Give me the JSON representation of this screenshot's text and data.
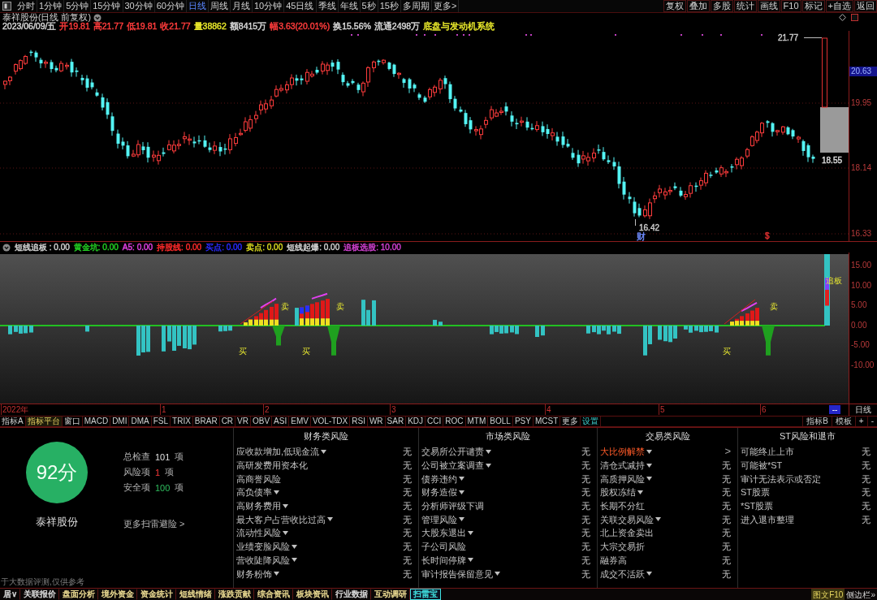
{
  "toolbar": {
    "periods": [
      {
        "label": "分时",
        "selected": false
      },
      {
        "label": "1分钟",
        "selected": false
      },
      {
        "label": "5分钟",
        "selected": false
      },
      {
        "label": "15分钟",
        "selected": false
      },
      {
        "label": "30分钟",
        "selected": false
      },
      {
        "label": "60分钟",
        "selected": false
      },
      {
        "label": "日线",
        "selected": true
      },
      {
        "label": "周线",
        "selected": false
      },
      {
        "label": "月线",
        "selected": false
      },
      {
        "label": "10分钟",
        "selected": false
      },
      {
        "label": "45日线",
        "selected": false
      },
      {
        "label": "季线",
        "selected": false
      },
      {
        "label": "年线",
        "selected": false
      },
      {
        "label": "5秒",
        "selected": false
      },
      {
        "label": "15秒",
        "selected": false
      },
      {
        "label": "多周期",
        "selected": false
      },
      {
        "label": "更多>",
        "selected": false
      }
    ],
    "actions": [
      "复权",
      "叠加",
      "多股",
      "统计",
      "画线",
      "F10",
      "标记",
      "+自选",
      "返回"
    ]
  },
  "stock_header": {
    "title": "泰祥股份(日线 前复权)"
  },
  "quote": [
    {
      "text": "2023/06/09/五",
      "color": "#d8d8d8"
    },
    {
      "text": "开19.81",
      "color": "#ff3c3c"
    },
    {
      "text": "高21.77",
      "color": "#ff3c3c"
    },
    {
      "text": "低19.81",
      "color": "#ff3c3c"
    },
    {
      "text": "收21.77",
      "color": "#ff3c3c"
    },
    {
      "text": "量38862",
      "color": "#e6e62a"
    },
    {
      "text": "额8415万",
      "color": "#d8d8d8"
    },
    {
      "text": "幅3.63(20.01%)",
      "color": "#ff3c3c"
    },
    {
      "text": "换15.56%",
      "color": "#d8d8d8"
    },
    {
      "text": "流通2498万",
      "color": "#d8d8d8"
    },
    {
      "text": "底盘与发动机系统",
      "color": "#e6e62a"
    }
  ],
  "price_chart": {
    "axis_labels": [
      {
        "text": "20.63",
        "kind": "current"
      },
      {
        "text": "19.95",
        "kind": "tick"
      },
      {
        "text": "18.14",
        "kind": "tick"
      },
      {
        "text": "16.33",
        "kind": "tick"
      }
    ],
    "annotations": [
      {
        "text": "21.77",
        "color": "#c8c8c8"
      },
      {
        "text": "18.55",
        "color": "#d8d8d8"
      },
      {
        "text": "16.42",
        "color": "#c8c8c8"
      },
      {
        "text": "财",
        "color": "#6f8cff"
      },
      {
        "text": "$",
        "color": "#e03030"
      }
    ]
  },
  "indicator": {
    "legend": [
      {
        "text": "短线追板 : 0.00",
        "color": "#d0d0d0"
      },
      {
        "text": "黄金坑: 0.00",
        "color": "#22cc22"
      },
      {
        "text": "A5: 0.00",
        "color": "#e040e0"
      },
      {
        "text": "持股线: 0.00",
        "color": "#ff2a2a"
      },
      {
        "text": "买点: 0.00",
        "color": "#2a2aff"
      },
      {
        "text": "卖点: 0.00",
        "color": "#d8d820"
      },
      {
        "text": "短线起爆: 0.00",
        "color": "#d0d0d0"
      },
      {
        "text": "追板选股: 10.00",
        "color": "#d040d0"
      }
    ],
    "axis_labels": [
      "15.00",
      "10.00",
      "5.00",
      "0.00",
      "-5.00",
      "-10.00"
    ],
    "markers": [
      "买",
      "卖",
      "买",
      "卖",
      "买",
      "卖",
      "追板"
    ]
  },
  "time_axis": {
    "labels": [
      "2022年",
      "1",
      "2",
      "3",
      "4",
      "5",
      "6"
    ],
    "cursor": "--",
    "period": "日线"
  },
  "indicator_tabs": {
    "items": [
      {
        "label": "指标A",
        "kind": "indicator",
        "selected": false
      },
      {
        "label": "指标平台",
        "kind": "indicator",
        "selected": true
      },
      {
        "label": "窗口",
        "kind": "indicator",
        "selected": false
      },
      {
        "label": "MACD",
        "kind": "indicator",
        "selected": false
      },
      {
        "label": "DMI",
        "kind": "indicator",
        "selected": false
      },
      {
        "label": "DMA",
        "kind": "indicator",
        "selected": false
      },
      {
        "label": "FSL",
        "kind": "indicator",
        "selected": false
      },
      {
        "label": "TRIX",
        "kind": "indicator",
        "selected": false
      },
      {
        "label": "BRAR",
        "kind": "indicator",
        "selected": false
      },
      {
        "label": "CR",
        "kind": "indicator",
        "selected": false
      },
      {
        "label": "VR",
        "kind": "indicator",
        "selected": false
      },
      {
        "label": "OBV",
        "kind": "indicator",
        "selected": false
      },
      {
        "label": "ASI",
        "kind": "indicator",
        "selected": false
      },
      {
        "label": "EMV",
        "kind": "indicator",
        "selected": false
      },
      {
        "label": "VOL-TDX",
        "kind": "indicator",
        "selected": false
      },
      {
        "label": "RSI",
        "kind": "indicator",
        "selected": false
      },
      {
        "label": "WR",
        "kind": "indicator",
        "selected": false
      },
      {
        "label": "SAR",
        "kind": "indicator",
        "selected": false
      },
      {
        "label": "KDJ",
        "kind": "indicator",
        "selected": false
      },
      {
        "label": "CCI",
        "kind": "indicator",
        "selected": false
      },
      {
        "label": "ROC",
        "kind": "indicator",
        "selected": false
      },
      {
        "label": "MTM",
        "kind": "indicator",
        "selected": false
      },
      {
        "label": "BOLL",
        "kind": "indicator",
        "selected": false
      },
      {
        "label": "PSY",
        "kind": "indicator",
        "selected": false
      },
      {
        "label": "MCST",
        "kind": "indicator",
        "selected": false
      },
      {
        "label": "更多",
        "kind": "indicator",
        "selected": false
      },
      {
        "label": "设置",
        "kind": "action",
        "selected": false
      }
    ],
    "right": [
      "指标B",
      "模板",
      "+",
      "-"
    ]
  },
  "risk_panel": {
    "score": "92分",
    "name": "泰祥股份",
    "stats": [
      {
        "label": "总检查",
        "count": "101",
        "unit": "项",
        "kind": "total"
      },
      {
        "label": "风险项",
        "count": "1",
        "unit": "项",
        "kind": "risk"
      },
      {
        "label": "安全项",
        "count": "100",
        "unit": "项",
        "kind": "safe"
      }
    ],
    "more_link": "更多扫雷避险 >",
    "disclaimer": "于大数据评测,仅供参考",
    "columns": [
      {
        "title": "财务类风险",
        "rows": [
          {
            "name": "应收款增加,低现金流",
            "expandable": true,
            "flagged": false,
            "result": "无"
          },
          {
            "name": "高研发费用资本化",
            "expandable": false,
            "flagged": false,
            "result": "无"
          },
          {
            "name": "高商誉风险",
            "expandable": false,
            "flagged": false,
            "result": "无"
          },
          {
            "name": "高负债率",
            "expandable": true,
            "flagged": false,
            "result": "无"
          },
          {
            "name": "高财务费用",
            "expandable": true,
            "flagged": false,
            "result": "无"
          },
          {
            "name": "最大客户占营收比过高",
            "expandable": true,
            "flagged": false,
            "result": "无"
          },
          {
            "name": "流动性风险",
            "expandable": true,
            "flagged": false,
            "result": "无"
          },
          {
            "name": "业绩变脸风险",
            "expandable": true,
            "flagged": false,
            "result": "无"
          },
          {
            "name": "营收陡降风险",
            "expandable": true,
            "flagged": false,
            "result": "无"
          },
          {
            "name": "财务粉饰",
            "expandable": true,
            "flagged": false,
            "result": "无"
          }
        ]
      },
      {
        "title": "市场类风险",
        "rows": [
          {
            "name": "交易所公开谴责",
            "expandable": true,
            "flagged": false,
            "result": "无"
          },
          {
            "name": "公司被立案调查",
            "expandable": true,
            "flagged": false,
            "result": "无"
          },
          {
            "name": "债券违约",
            "expandable": true,
            "flagged": false,
            "result": "无"
          },
          {
            "name": "财务造假",
            "expandable": true,
            "flagged": false,
            "result": "无"
          },
          {
            "name": "分析师评级下调",
            "expandable": false,
            "flagged": false,
            "result": "无"
          },
          {
            "name": "管理风险",
            "expandable": true,
            "flagged": false,
            "result": "无"
          },
          {
            "name": "大股东退出",
            "expandable": true,
            "flagged": false,
            "result": "无"
          },
          {
            "name": "子公司风险",
            "expandable": false,
            "flagged": false,
            "result": "无"
          },
          {
            "name": "长时间停牌",
            "expandable": true,
            "flagged": false,
            "result": "无"
          },
          {
            "name": "审计报告保留意见",
            "expandable": true,
            "flagged": false,
            "result": "无"
          }
        ]
      },
      {
        "title": "交易类风险",
        "rows": [
          {
            "name": "大比例解禁",
            "expandable": true,
            "flagged": true,
            "result": ">"
          },
          {
            "name": "清仓式减持",
            "expandable": true,
            "flagged": false,
            "result": "无"
          },
          {
            "name": "高质押风险",
            "expandable": true,
            "flagged": false,
            "result": "无"
          },
          {
            "name": "股权冻结",
            "expandable": true,
            "flagged": false,
            "result": "无"
          },
          {
            "name": "长期不分红",
            "expandable": false,
            "flagged": false,
            "result": "无"
          },
          {
            "name": "关联交易风险",
            "expandable": true,
            "flagged": false,
            "result": "无"
          },
          {
            "name": "北上资金卖出",
            "expandable": false,
            "flagged": false,
            "result": "无"
          },
          {
            "name": "大宗交易折",
            "expandable": false,
            "flagged": false,
            "result": "无"
          },
          {
            "name": "融券高",
            "expandable": false,
            "flagged": false,
            "result": "无"
          },
          {
            "name": "成交不活跃",
            "expandable": true,
            "flagged": false,
            "result": "无"
          }
        ]
      },
      {
        "title": "ST风险和退市",
        "rows": [
          {
            "name": "可能终止上市",
            "expandable": false,
            "flagged": false,
            "result": "无"
          },
          {
            "name": "可能被*ST",
            "expandable": false,
            "flagged": false,
            "result": "无"
          },
          {
            "name": "审计无法表示或否定",
            "expandable": false,
            "flagged": false,
            "result": "无"
          },
          {
            "name": "ST股票",
            "expandable": false,
            "flagged": false,
            "result": "无"
          },
          {
            "name": "*ST股票",
            "expandable": false,
            "flagged": false,
            "result": "无"
          },
          {
            "name": "进入退市整理",
            "expandable": false,
            "flagged": false,
            "result": "无"
          }
        ]
      }
    ]
  },
  "status_bar": {
    "tabs": [
      {
        "label": "居∨",
        "color": "#d8d8d8",
        "selected": false
      },
      {
        "label": "关联报价",
        "color": "#d8d8d8",
        "selected": false
      },
      {
        "label": "盘面分析",
        "color": "#e8d890",
        "selected": false
      },
      {
        "label": "境外资金",
        "color": "#e8d890",
        "selected": false
      },
      {
        "label": "资金统计",
        "color": "#e8d890",
        "selected": false
      },
      {
        "label": "短线情绪",
        "color": "#e8d890",
        "selected": false
      },
      {
        "label": "涨跌贡献",
        "color": "#e8d890",
        "selected": false
      },
      {
        "label": "综合资讯",
        "color": "#e8d890",
        "selected": false
      },
      {
        "label": "板块资讯",
        "color": "#e8d890",
        "selected": false
      },
      {
        "label": "行业数据",
        "color": "#d8d8d8",
        "selected": false
      },
      {
        "label": "互动调研",
        "color": "#e8d890",
        "selected": false
      },
      {
        "label": "扫雷宝",
        "color": "#40e0e0",
        "selected": true
      }
    ],
    "right": [
      {
        "label": "图文F10",
        "selected": true
      },
      {
        "label": "侧边栏»",
        "selected": false
      }
    ]
  }
}
